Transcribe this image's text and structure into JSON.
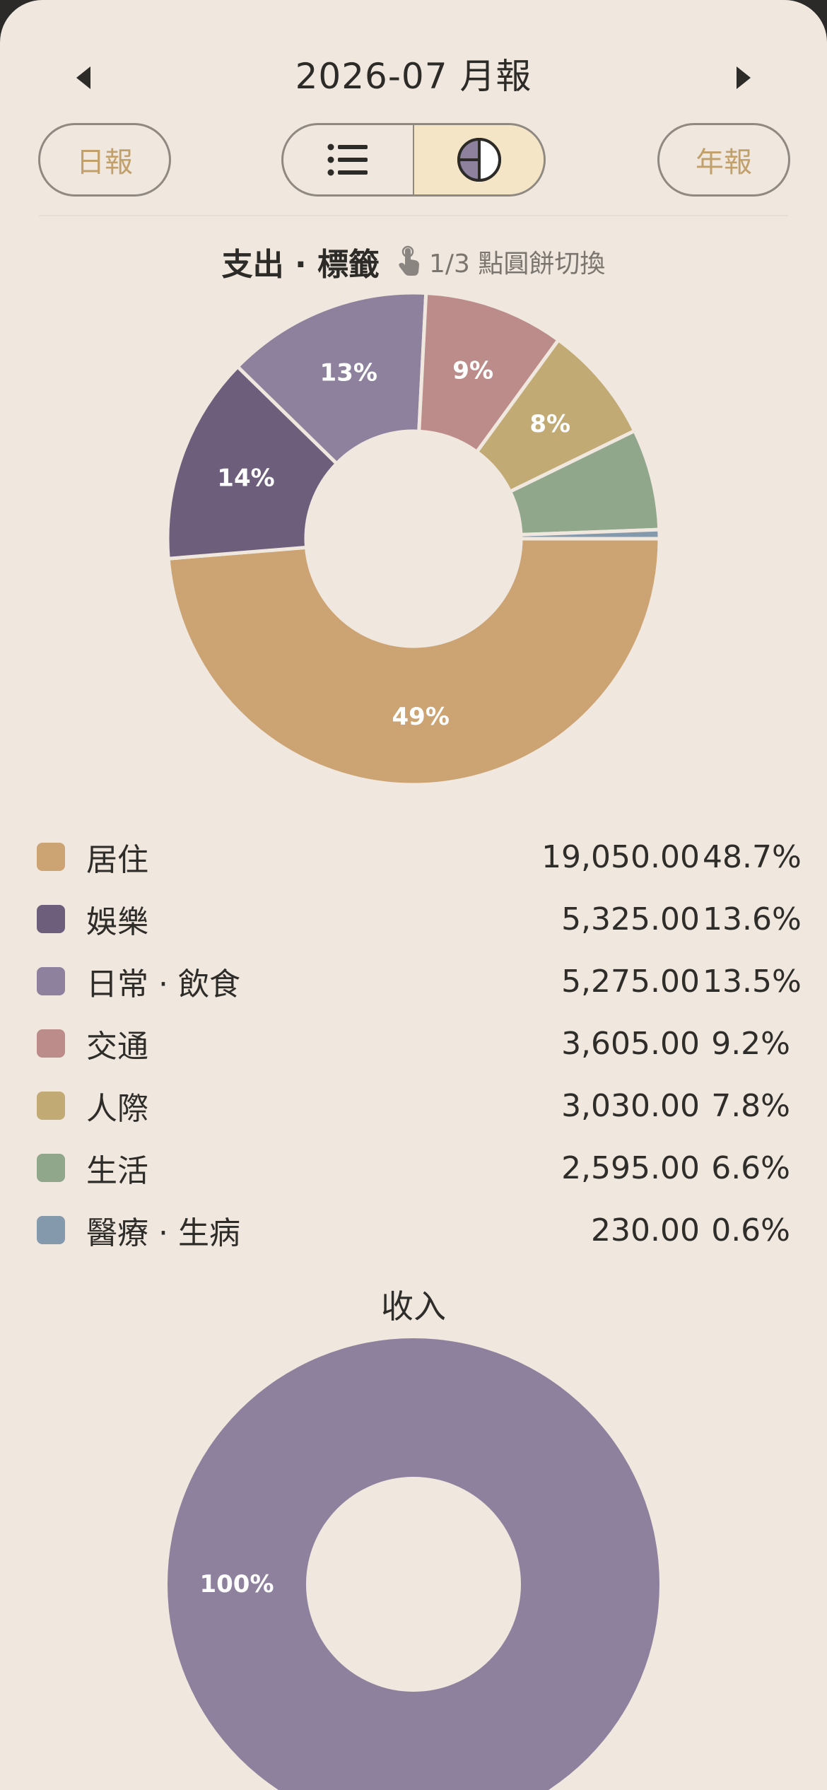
{
  "header": {
    "title": "2026-07 月報",
    "prev_icon": "caret-left-icon",
    "next_icon": "caret-right-icon",
    "daily_label": "日報",
    "yearly_label": "年報",
    "view_list_icon": "list-icon",
    "view_chart_icon": "pie-chart-icon",
    "active_view": "chart"
  },
  "expense": {
    "title": "支出 · 標籤",
    "hint_icon": "tap-hand-icon",
    "hint": "1/3 點圓餅切換"
  },
  "income": {
    "title": "收入"
  },
  "colors": {
    "background": "#f0e8df",
    "accent": "#c1a06b",
    "toggle_active": "#f4e5c6"
  },
  "chart_data": [
    {
      "type": "pie",
      "title": "支出 · 標籤",
      "donut": true,
      "slices": [
        {
          "label": "居住",
          "value": 19050.0,
          "amount": "19,050.00",
          "percent": "48.7%",
          "pie_label": "49%",
          "color": "#cca373"
        },
        {
          "label": "娛樂",
          "value": 5325.0,
          "amount": "5,325.00",
          "percent": "13.6%",
          "pie_label": "14%",
          "color": "#6d5e7c"
        },
        {
          "label": "日常 · 飲食",
          "value": 5275.0,
          "amount": "5,275.00",
          "percent": "13.5%",
          "pie_label": "13%",
          "color": "#8e819d"
        },
        {
          "label": "交通",
          "value": 3605.0,
          "amount": "3,605.00",
          "percent": "9.2%",
          "pie_label": "9%",
          "color": "#bb8c89"
        },
        {
          "label": "人際",
          "value": 3030.0,
          "amount": "3,030.00",
          "percent": "7.8%",
          "pie_label": "8%",
          "color": "#c2aa74"
        },
        {
          "label": "生活",
          "value": 2595.0,
          "amount": "2,595.00",
          "percent": "6.6%",
          "pie_label": "",
          "color": "#90a78c"
        },
        {
          "label": "醫療 · 生病",
          "value": 230.0,
          "amount": "230.00",
          "percent": "0.6%",
          "pie_label": "",
          "color": "#8599ad"
        }
      ]
    },
    {
      "type": "pie",
      "title": "收入",
      "donut": true,
      "slices": [
        {
          "label": "",
          "value": 100,
          "pie_label": "100%",
          "color": "#8e819d"
        }
      ]
    }
  ]
}
